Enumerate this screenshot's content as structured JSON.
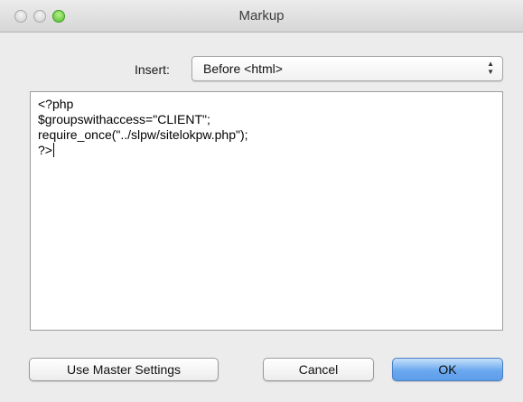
{
  "window": {
    "title": "Markup"
  },
  "insert": {
    "label": "Insert:",
    "selected": "Before <html>"
  },
  "editor": {
    "lines": [
      "<?php",
      "$groupswithaccess=\"CLIENT\";",
      "require_once(\"../slpw/sitelokpw.php\");",
      "?>"
    ]
  },
  "buttons": {
    "master": "Use Master Settings",
    "cancel": "Cancel",
    "ok": "OK"
  },
  "colors": {
    "window_bg": "#ececec",
    "default_button": "#6aa9ef",
    "zoom_button": "#4fbf2b"
  }
}
